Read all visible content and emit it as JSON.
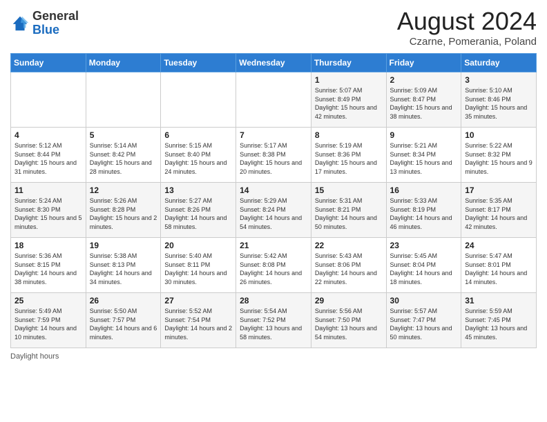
{
  "header": {
    "logo_general": "General",
    "logo_blue": "Blue",
    "month_year": "August 2024",
    "location": "Czarne, Pomerania, Poland"
  },
  "days_of_week": [
    "Sunday",
    "Monday",
    "Tuesday",
    "Wednesday",
    "Thursday",
    "Friday",
    "Saturday"
  ],
  "weeks": [
    [
      {
        "day": "",
        "info": ""
      },
      {
        "day": "",
        "info": ""
      },
      {
        "day": "",
        "info": ""
      },
      {
        "day": "",
        "info": ""
      },
      {
        "day": "1",
        "info": "Sunrise: 5:07 AM\nSunset: 8:49 PM\nDaylight: 15 hours and 42 minutes."
      },
      {
        "day": "2",
        "info": "Sunrise: 5:09 AM\nSunset: 8:47 PM\nDaylight: 15 hours and 38 minutes."
      },
      {
        "day": "3",
        "info": "Sunrise: 5:10 AM\nSunset: 8:46 PM\nDaylight: 15 hours and 35 minutes."
      }
    ],
    [
      {
        "day": "4",
        "info": "Sunrise: 5:12 AM\nSunset: 8:44 PM\nDaylight: 15 hours and 31 minutes."
      },
      {
        "day": "5",
        "info": "Sunrise: 5:14 AM\nSunset: 8:42 PM\nDaylight: 15 hours and 28 minutes."
      },
      {
        "day": "6",
        "info": "Sunrise: 5:15 AM\nSunset: 8:40 PM\nDaylight: 15 hours and 24 minutes."
      },
      {
        "day": "7",
        "info": "Sunrise: 5:17 AM\nSunset: 8:38 PM\nDaylight: 15 hours and 20 minutes."
      },
      {
        "day": "8",
        "info": "Sunrise: 5:19 AM\nSunset: 8:36 PM\nDaylight: 15 hours and 17 minutes."
      },
      {
        "day": "9",
        "info": "Sunrise: 5:21 AM\nSunset: 8:34 PM\nDaylight: 15 hours and 13 minutes."
      },
      {
        "day": "10",
        "info": "Sunrise: 5:22 AM\nSunset: 8:32 PM\nDaylight: 15 hours and 9 minutes."
      }
    ],
    [
      {
        "day": "11",
        "info": "Sunrise: 5:24 AM\nSunset: 8:30 PM\nDaylight: 15 hours and 5 minutes."
      },
      {
        "day": "12",
        "info": "Sunrise: 5:26 AM\nSunset: 8:28 PM\nDaylight: 15 hours and 2 minutes."
      },
      {
        "day": "13",
        "info": "Sunrise: 5:27 AM\nSunset: 8:26 PM\nDaylight: 14 hours and 58 minutes."
      },
      {
        "day": "14",
        "info": "Sunrise: 5:29 AM\nSunset: 8:24 PM\nDaylight: 14 hours and 54 minutes."
      },
      {
        "day": "15",
        "info": "Sunrise: 5:31 AM\nSunset: 8:21 PM\nDaylight: 14 hours and 50 minutes."
      },
      {
        "day": "16",
        "info": "Sunrise: 5:33 AM\nSunset: 8:19 PM\nDaylight: 14 hours and 46 minutes."
      },
      {
        "day": "17",
        "info": "Sunrise: 5:35 AM\nSunset: 8:17 PM\nDaylight: 14 hours and 42 minutes."
      }
    ],
    [
      {
        "day": "18",
        "info": "Sunrise: 5:36 AM\nSunset: 8:15 PM\nDaylight: 14 hours and 38 minutes."
      },
      {
        "day": "19",
        "info": "Sunrise: 5:38 AM\nSunset: 8:13 PM\nDaylight: 14 hours and 34 minutes."
      },
      {
        "day": "20",
        "info": "Sunrise: 5:40 AM\nSunset: 8:11 PM\nDaylight: 14 hours and 30 minutes."
      },
      {
        "day": "21",
        "info": "Sunrise: 5:42 AM\nSunset: 8:08 PM\nDaylight: 14 hours and 26 minutes."
      },
      {
        "day": "22",
        "info": "Sunrise: 5:43 AM\nSunset: 8:06 PM\nDaylight: 14 hours and 22 minutes."
      },
      {
        "day": "23",
        "info": "Sunrise: 5:45 AM\nSunset: 8:04 PM\nDaylight: 14 hours and 18 minutes."
      },
      {
        "day": "24",
        "info": "Sunrise: 5:47 AM\nSunset: 8:01 PM\nDaylight: 14 hours and 14 minutes."
      }
    ],
    [
      {
        "day": "25",
        "info": "Sunrise: 5:49 AM\nSunset: 7:59 PM\nDaylight: 14 hours and 10 minutes."
      },
      {
        "day": "26",
        "info": "Sunrise: 5:50 AM\nSunset: 7:57 PM\nDaylight: 14 hours and 6 minutes."
      },
      {
        "day": "27",
        "info": "Sunrise: 5:52 AM\nSunset: 7:54 PM\nDaylight: 14 hours and 2 minutes."
      },
      {
        "day": "28",
        "info": "Sunrise: 5:54 AM\nSunset: 7:52 PM\nDaylight: 13 hours and 58 minutes."
      },
      {
        "day": "29",
        "info": "Sunrise: 5:56 AM\nSunset: 7:50 PM\nDaylight: 13 hours and 54 minutes."
      },
      {
        "day": "30",
        "info": "Sunrise: 5:57 AM\nSunset: 7:47 PM\nDaylight: 13 hours and 50 minutes."
      },
      {
        "day": "31",
        "info": "Sunrise: 5:59 AM\nSunset: 7:45 PM\nDaylight: 13 hours and 45 minutes."
      }
    ]
  ],
  "footer": {
    "daylight_label": "Daylight hours"
  }
}
